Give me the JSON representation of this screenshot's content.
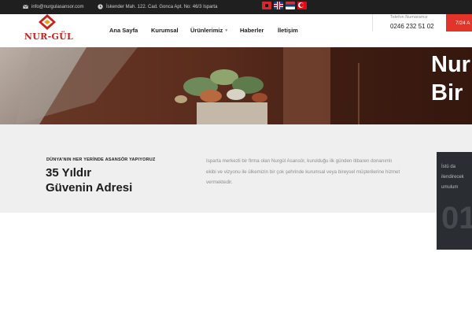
{
  "topbar": {
    "email": "info@nurgulasansor.com",
    "address": "İskender Mah. 122. Cad. Gonca Apt. No: 46/3 Isparta",
    "languages": [
      "Arnavutça",
      "English",
      "Srpski",
      "Türkçe"
    ]
  },
  "header": {
    "logo_text": "NUR-GÜL",
    "nav": [
      "Ana Sayfa",
      "Kurumsal",
      "Ürünlerimiz",
      "Haberler",
      "İletişim"
    ],
    "phone_label": "Telefon Numaramız",
    "phone_number": "0246 232 51 02",
    "cta_label": "7/24 A"
  },
  "hero": {
    "title_line1": "Nur",
    "title_line2": "Bir"
  },
  "intro": {
    "tagline": "DÜNYA'NIN HER YERİNDE ASANSÖR YAPIYORUZ",
    "headline_line1": "35 Yıldır",
    "headline_line2": "Güvenin Adresi",
    "description_lines": [
      "Isparta merkezli bir firma olan Nurgül Asansör, kurulduğu ilk günden itibaren donanımlı",
      "ekibi ve vizyonu ile ülkemizin bir çok şehrinde kurumsal veya bireysel müşterilerine hizmet",
      "vermektedir."
    ]
  },
  "side_card": {
    "lines": [
      "İstü da",
      "ilendirecek",
      "umulum"
    ],
    "big_text": "01"
  },
  "colors": {
    "accent": "#e3342a",
    "logo_red": "#c6231c",
    "topbar": "#1f1f1f",
    "intro_bg": "#efefef",
    "card_bg": "#2a2d31"
  }
}
